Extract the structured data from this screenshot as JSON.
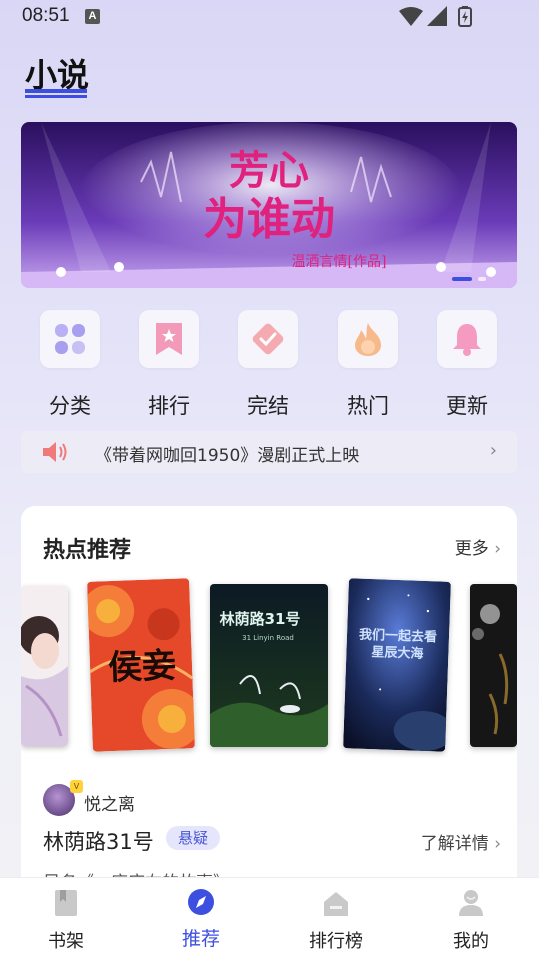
{
  "status_bar": {
    "time": "08:51",
    "notification_letter": "A"
  },
  "header": {
    "title": "小说"
  },
  "banner": {
    "title_line1": "芳心",
    "title_line2": "为谁动",
    "subtitle": "温酒言情[作品]",
    "slide_index": 1,
    "slide_count": 2
  },
  "categories": [
    {
      "label": "分类",
      "icon": "grid-flower-icon"
    },
    {
      "label": "排行",
      "icon": "bookmark-star-icon"
    },
    {
      "label": "完结",
      "icon": "check-box-icon"
    },
    {
      "label": "热门",
      "icon": "flame-icon"
    },
    {
      "label": "更新",
      "icon": "bell-icon"
    }
  ],
  "notice": {
    "text": "《带着网咖回1950》漫剧正式上映",
    "icon": "speaker-icon"
  },
  "hot_section": {
    "title": "热点推荐",
    "more_label": "更多",
    "books": [
      {
        "title": "",
        "cover": "girl-portrait"
      },
      {
        "title": "侯妾",
        "cover": "feather-red"
      },
      {
        "title": "林荫路31号",
        "subtitle": "31 Linyin Road",
        "cover": "night-flower"
      },
      {
        "title": "我们一起去看星辰大海",
        "cover": "space-sky"
      },
      {
        "title": "",
        "cover": "dark-ink"
      }
    ],
    "featured": {
      "author": "悦之离",
      "author_badge": "V",
      "book_title": "林荫路31号",
      "genre": "悬疑",
      "detail_label": "了解详情",
      "description": "另名《一座序右的故事》"
    }
  },
  "bottom_nav": [
    {
      "label": "书架",
      "icon": "bookshelf-icon",
      "active": false
    },
    {
      "label": "推荐",
      "icon": "compass-icon",
      "active": true
    },
    {
      "label": "排行榜",
      "icon": "ranking-icon",
      "active": false
    },
    {
      "label": "我的",
      "icon": "profile-icon",
      "active": false
    }
  ],
  "colors": {
    "accent": "#3d4fe0",
    "tag_bg": "#e5e6fb"
  }
}
